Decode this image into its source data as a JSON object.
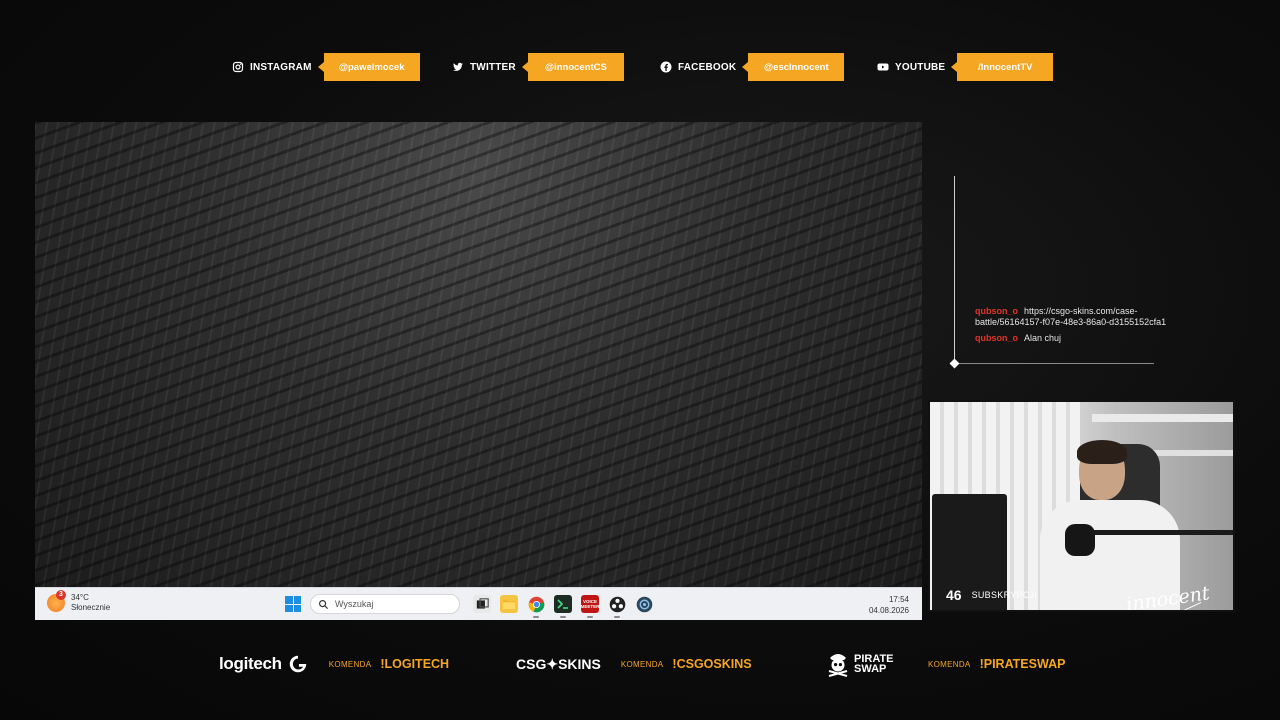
{
  "social": [
    {
      "label": "INSTAGRAM",
      "handle": "@pawelmocek",
      "icon": "instagram-icon"
    },
    {
      "label": "TWITTER",
      "handle": "@innocentCS",
      "icon": "twitter-icon"
    },
    {
      "label": "FACEBOOK",
      "handle": "@escInnocent",
      "icon": "facebook-icon"
    },
    {
      "label": "YOUTUBE",
      "handle": "/InnocentTV",
      "icon": "youtube-icon"
    }
  ],
  "taskbar": {
    "weather_temp": "34°C",
    "weather_desc": "Słonecznie",
    "weather_badge": "3",
    "search_placeholder": "Wyszukaj",
    "time": "17:54",
    "date": "04.08.2026",
    "apps": [
      "task-view",
      "file-explorer",
      "chrome",
      "terminal",
      "voicemeeter",
      "obs",
      "steam"
    ],
    "voicemeeter_label": "VOICE MEETER"
  },
  "chat": {
    "messages": [
      {
        "user": "qubson_o",
        "text": "https://csgo-skins.com/case-battle/56164157-f07e-48e3-86a0-d3155152cfa1"
      },
      {
        "user": "qubson_o",
        "text": "Alan chuj"
      }
    ]
  },
  "webcam": {
    "sub_count": "46",
    "sub_label": "SUBSKRYPCJI",
    "signature": "innocent"
  },
  "sponsors": [
    {
      "name": "logitech",
      "keyword": "KOMENDA",
      "command": "!LOGITECH"
    },
    {
      "name": "CSG✦SKINS",
      "keyword": "KOMENDA",
      "command": "!CSGOSKINS"
    },
    {
      "name": "PIRATE SWAP",
      "keyword": "KOMENDA",
      "command": "!PIRATESWAP"
    }
  ],
  "colors": {
    "accent": "#f5a623",
    "chat_user": "#e0342b"
  }
}
